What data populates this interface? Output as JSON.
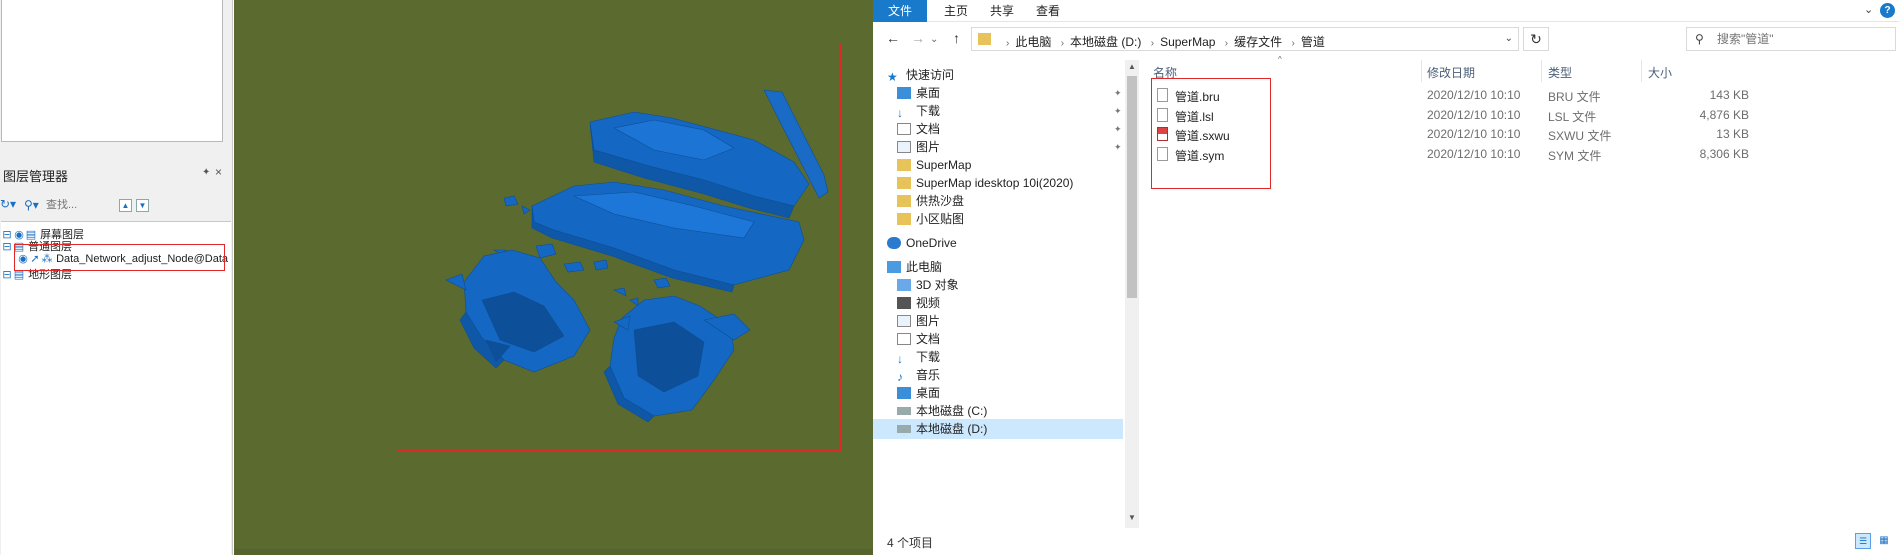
{
  "layer_panel": {
    "title": "图层管理器",
    "pin_icon": "pin-icon",
    "close_icon": "close-icon",
    "search_placeholder": "查找...",
    "layers": [
      {
        "label": "屏幕图层"
      },
      {
        "label": "普通图层"
      },
      {
        "label": "Data_Network_adjust_Node@Data"
      },
      {
        "label": "地形图层"
      }
    ]
  },
  "viewport": {
    "background": "#5b6a2f",
    "model_color": "#1565c0",
    "highlight_color": "#e02828"
  },
  "explorer": {
    "ribbon_tabs": [
      "文件",
      "主页",
      "共享",
      "查看"
    ],
    "breadcrumb": [
      "此电脑",
      "本地磁盘 (D:)",
      "SuperMap",
      "缓存文件",
      "管道"
    ],
    "search_placeholder": "搜索\"管道\"",
    "nav": [
      {
        "label": "快速访问",
        "icon": "star-icon",
        "pinned": false
      },
      {
        "label": "桌面",
        "icon": "desktop-icon",
        "pinned": true
      },
      {
        "label": "下载",
        "icon": "download-icon",
        "pinned": true
      },
      {
        "label": "文档",
        "icon": "document-icon",
        "pinned": true
      },
      {
        "label": "图片",
        "icon": "picture-icon",
        "pinned": true
      },
      {
        "label": "SuperMap",
        "icon": "folder-icon",
        "pinned": false
      },
      {
        "label": "SuperMap idesktop 10i(2020)",
        "icon": "folder-icon",
        "pinned": false
      },
      {
        "label": "供热沙盘",
        "icon": "folder-icon",
        "pinned": false
      },
      {
        "label": "小区贴图",
        "icon": "folder-icon",
        "pinned": false
      },
      {
        "label": "OneDrive",
        "icon": "cloud-icon",
        "pinned": false
      },
      {
        "label": "此电脑",
        "icon": "computer-icon",
        "pinned": false
      },
      {
        "label": "3D 对象",
        "icon": "cube-icon",
        "pinned": false
      },
      {
        "label": "视频",
        "icon": "video-icon",
        "pinned": false
      },
      {
        "label": "图片",
        "icon": "picture-icon",
        "pinned": false
      },
      {
        "label": "文档",
        "icon": "document-icon",
        "pinned": false
      },
      {
        "label": "下载",
        "icon": "download-icon",
        "pinned": false
      },
      {
        "label": "音乐",
        "icon": "music-icon",
        "pinned": false
      },
      {
        "label": "桌面",
        "icon": "desktop-icon",
        "pinned": false
      },
      {
        "label": "本地磁盘 (C:)",
        "icon": "drive-icon",
        "pinned": false
      },
      {
        "label": "本地磁盘 (D:)",
        "icon": "drive-icon",
        "pinned": false
      }
    ],
    "columns": [
      "名称",
      "修改日期",
      "类型",
      "大小"
    ],
    "files": [
      {
        "name": "管道.bru",
        "date": "2020/12/10 10:10",
        "type": "BRU 文件",
        "size": "143 KB"
      },
      {
        "name": "管道.lsl",
        "date": "2020/12/10 10:10",
        "type": "LSL 文件",
        "size": "4,876 KB"
      },
      {
        "name": "管道.sxwu",
        "date": "2020/12/10 10:10",
        "type": "SXWU 文件",
        "size": "13 KB"
      },
      {
        "name": "管道.sym",
        "date": "2020/12/10 10:10",
        "type": "SYM 文件",
        "size": "8,306 KB"
      }
    ],
    "status": "4 个项目",
    "accent": "#1979ca"
  }
}
